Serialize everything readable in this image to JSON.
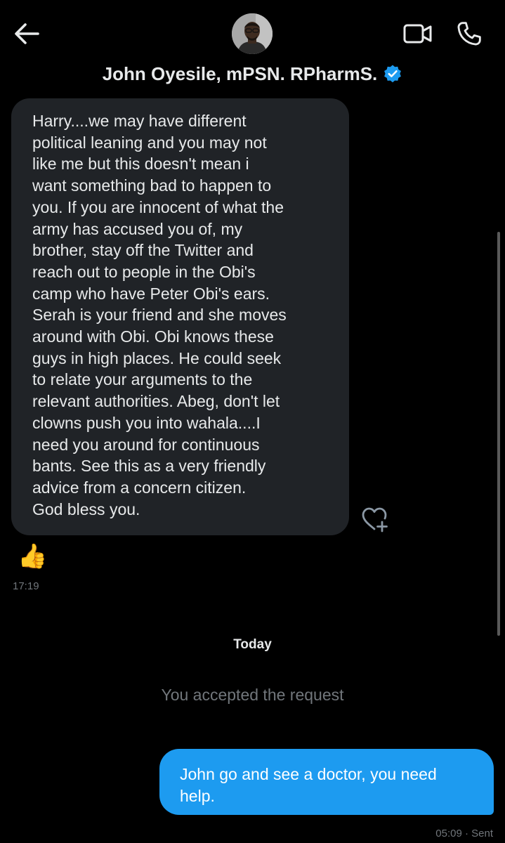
{
  "header": {
    "contact_name": "John Oyesile, mPSN. RPharmS.",
    "back_icon": "arrow-left-icon",
    "video_icon": "video-camera-icon",
    "call_icon": "phone-icon",
    "verified_icon": "verified-badge-icon"
  },
  "messages": {
    "incoming": {
      "lines": [
        "Harry....we may have different",
        "political leaning and you may not",
        "like me but this doesn't mean  i",
        "want something bad to happen to",
        "you. If you are innocent of what the",
        "army has accused you of, my",
        "brother,  stay off the Twitter and",
        "reach out to people in the Obi's",
        "camp who have Peter Obi's ears.",
        "Serah is your friend and she moves",
        "around with Obi. Obi knows these",
        "guys in high places. He could seek",
        "to relate your arguments to the",
        "relevant authorities.  Abeg, don't let",
        "clowns push you into wahala....I",
        "need you around for continuous",
        "bants. See this as a very friendly",
        "advice from a concern citizen.",
        "God bless you."
      ],
      "reaction_emoji": "👍",
      "time": "17:19"
    },
    "day_separator": "Today",
    "system_message": "You accepted the request",
    "outgoing": {
      "lines": [
        "John go and see a doctor, you need",
        "help."
      ],
      "status": "05:09 · Sent"
    }
  },
  "colors": {
    "background": "#000000",
    "incoming_bubble": "#202327",
    "outgoing_bubble": "#1d9bf0",
    "muted_text": "#71767b",
    "verified_blue": "#1d9bf0"
  }
}
